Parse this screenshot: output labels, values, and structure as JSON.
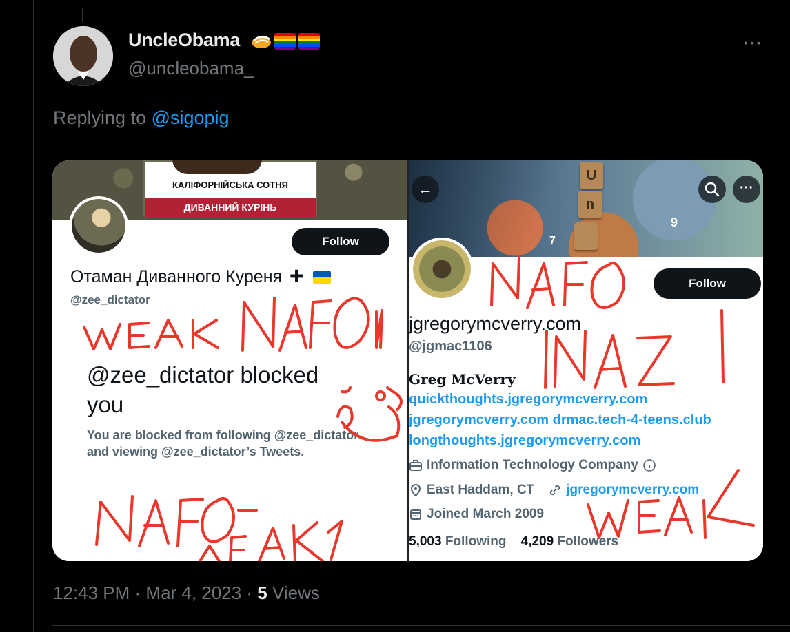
{
  "tweet": {
    "display_name": "UncleObama",
    "handle": "@uncleobama_",
    "replying_prefix": "Replying to ",
    "replying_to": "@sigopig",
    "time": "12:43 PM",
    "sep1": " · ",
    "date": "Mar 4, 2023",
    "sep2": " · ",
    "views_count": "5",
    "views_label": " Views",
    "more_icon": "···"
  },
  "left_panel": {
    "banner_top": "КАЛІФОРНІЙСЬКА СОТНЯ",
    "banner_bottom": "ДИВАННИЙ КУРІНЬ",
    "follow_label": "Follow",
    "name": "Отаман Диванного Куреня",
    "name_cross": "✚",
    "handle": "@zee_dictator",
    "blocked_title": "@zee_dictator blocked you",
    "blocked_desc": "You are blocked from following @zee_dictator and viewing @zee_dictator’s Tweets."
  },
  "right_panel": {
    "back_icon": "←",
    "more_icon": "···",
    "follow_label": "Follow",
    "name": "jgregorymcverry.com",
    "handle": "@jgmac1106",
    "bio_name": "Greg McVerry",
    "links": [
      "quickthoughts.jgregorymcverry.com",
      "jgregorymcverry.com drmac.tech-4-teens.club",
      "longthoughts.jgregorymcverry.com"
    ],
    "category": "Information Technology Company",
    "location": "East Haddam, CT",
    "website": "jgregorymcverry.com",
    "joined": "Joined March 2009",
    "following_count": "5,003",
    "following_label": "Following",
    "followers_count": "4,209",
    "followers_label": "Followers",
    "banner_tiles": [
      "U",
      "n",
      "9",
      "7"
    ]
  },
  "scribbles": {
    "left_top": "WEAK NAFO",
    "left_bottom": "NAFO WEAK",
    "right_top": "NAFO",
    "right_mid": "NAZI",
    "right_bottom": "WEAK"
  },
  "colors": {
    "accent": "#1d9bf0",
    "background": "#000000",
    "muted": "#71767b",
    "scribble_red": "#e8382c"
  }
}
